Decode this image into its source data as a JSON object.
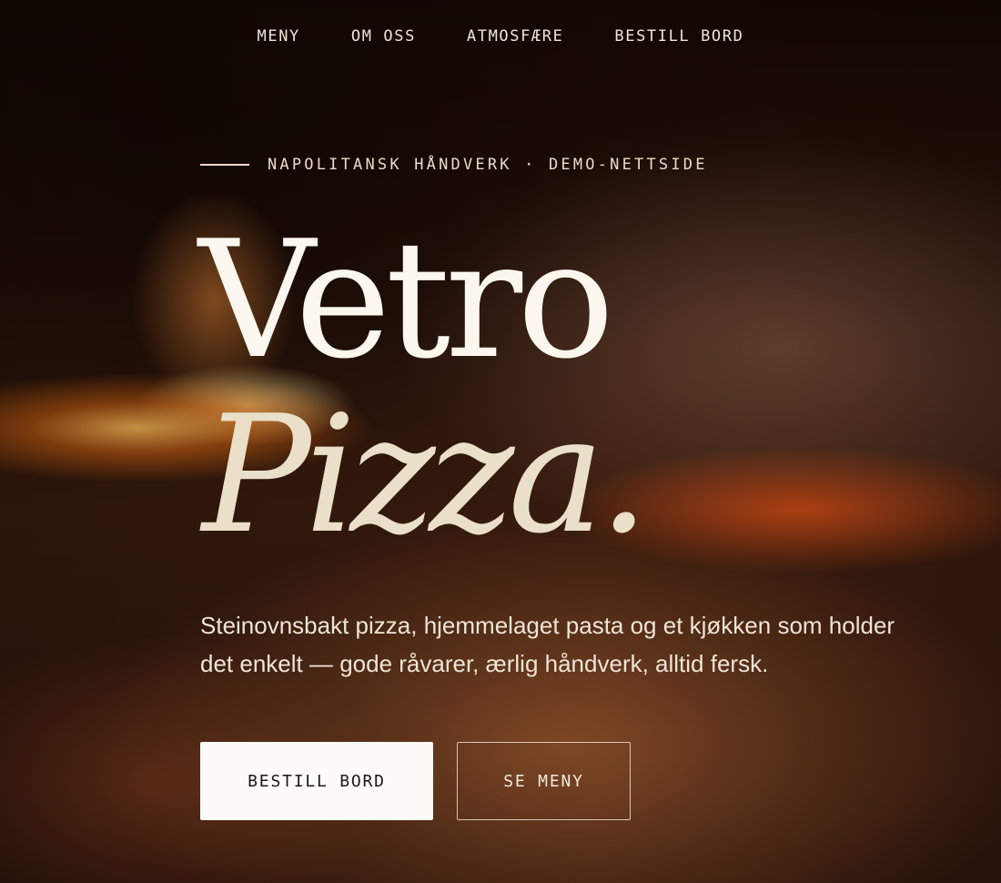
{
  "nav": {
    "items": [
      {
        "label": "MENY"
      },
      {
        "label": "OM OSS"
      },
      {
        "label": "ATMOSFÆRE"
      },
      {
        "label": "BESTILL BORD"
      }
    ]
  },
  "hero": {
    "eyebrow": "NAPOLITANSK HÅNDVERK · DEMO-NETTSIDE",
    "title_line1": "Vetro",
    "title_line2": "Pizza.",
    "lead": "Steinovnsbakt pizza, hjemmelaget pasta og et kjøkken som holder det enkelt — gode råvarer, ærlig håndverk, alltid fersk.",
    "primary_button": "BESTILL BORD",
    "secondary_button": "SE MENY"
  },
  "colors": {
    "cream": "#fbf6ee",
    "accent_cream": "#eadfc8",
    "dark": "#1f1712"
  }
}
